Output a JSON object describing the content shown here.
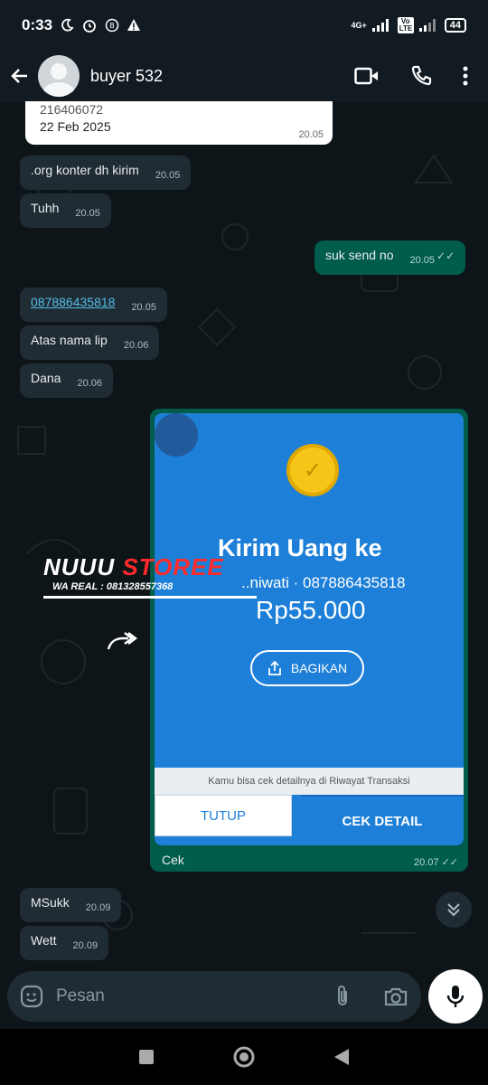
{
  "status_bar": {
    "time": "0:33",
    "network": "4G+",
    "volte": "Vo LTE",
    "battery": "44"
  },
  "header": {
    "contact_name": "buyer 532"
  },
  "messages": {
    "quoted": {
      "line1": "216406072",
      "line2": "22 Feb 2025",
      "time": "20.05"
    },
    "m1": {
      "text": ".org konter dh kirim",
      "time": "20.05"
    },
    "m2": {
      "text": "Tuhh",
      "time": "20.05"
    },
    "m3": {
      "text": "suk send no",
      "time": "20.05"
    },
    "m4": {
      "text": "087886435818",
      "time": "20.05"
    },
    "m5": {
      "text": "Atas nama lip",
      "time": "20.06"
    },
    "m6": {
      "text": "Dana",
      "time": "20.06"
    },
    "image_msg": {
      "title": "Kirim Uang ke",
      "recipient": "..niwati · 087886435818",
      "amount": "Rp55.000",
      "share_label": "BAGIKAN",
      "note": "Kamu bisa cek detailnya di Riwayat Transaksi",
      "btn_close": "TUTUP",
      "btn_detail": "CEK DETAIL",
      "caption": "Cek",
      "time": "20.07"
    },
    "m8": {
      "text": "MSukk",
      "time": "20.09"
    },
    "m9": {
      "text": "Wett",
      "time": "20.09"
    }
  },
  "watermark": {
    "title_white": "NUUU",
    "title_red": " STOREE",
    "subtitle": "WA REAL : 081328557368"
  },
  "composer": {
    "placeholder": "Pesan"
  },
  "colors": {
    "incoming_bubble": "#202c33",
    "outgoing_bubble": "#005c4b",
    "link": "#53bdeb",
    "dana_blue": "#1d7fd8"
  }
}
